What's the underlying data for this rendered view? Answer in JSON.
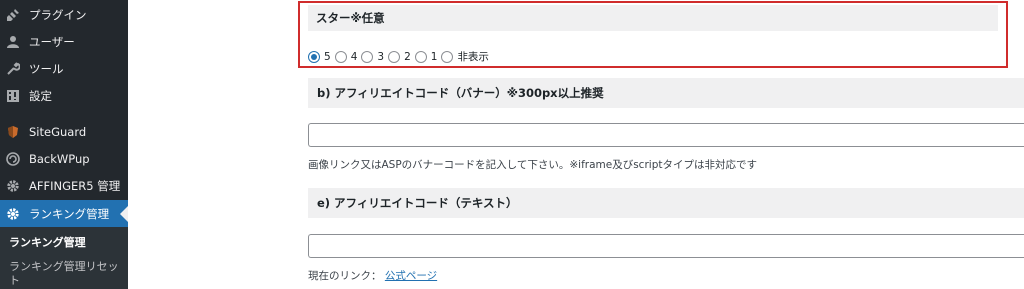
{
  "sidebar": {
    "items": [
      {
        "label": "プラグイン",
        "icon": "plugin-icon"
      },
      {
        "label": "ユーザー",
        "icon": "user-icon"
      },
      {
        "label": "ツール",
        "icon": "wrench-icon"
      },
      {
        "label": "設定",
        "icon": "settings-icon"
      },
      {
        "label": "SiteGuard",
        "icon": "siteguard-icon"
      },
      {
        "label": "BackWPup",
        "icon": "backwpup-icon"
      },
      {
        "label": "AFFINGER5 管理",
        "icon": "gear-icon"
      },
      {
        "label": "ランキング管理",
        "icon": "gear-icon"
      }
    ],
    "submenu": [
      "ランキング管理",
      "ランキング管理リセット"
    ],
    "colors": {
      "bg": "#23282d",
      "active": "#2271b1",
      "submenu_bg": "#2c3338"
    }
  },
  "main": {
    "star": {
      "heading": "スター※任意",
      "options": [
        "5",
        "4",
        "3",
        "2",
        "1",
        "非表示"
      ],
      "selected": "5",
      "highlight_color": "#d02c2c"
    },
    "banner": {
      "heading": "b) アフィリエイトコード（バナー）※300px以上推奨",
      "value": "",
      "help": "画像リンク又はASPのバナーコードを記入して下さい。※iframe及びscriptタイプは非対応です"
    },
    "text_code": {
      "heading": "e) アフィリエイトコード（テキスト）",
      "value": ""
    },
    "current_link": {
      "label": "現在のリンク：",
      "link_text": "公式ページ"
    }
  }
}
